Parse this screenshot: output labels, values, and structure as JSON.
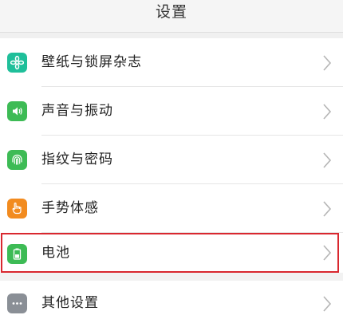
{
  "header": {
    "title": "设置"
  },
  "items": [
    {
      "label": "壁纸与锁屏杂志",
      "icon": "flower-icon",
      "color": "#1fbf9a"
    },
    {
      "label": "声音与振动",
      "icon": "speaker-icon",
      "color": "#3dbb55"
    },
    {
      "label": "指纹与密码",
      "icon": "fingerprint-icon",
      "color": "#3dbb55"
    },
    {
      "label": "手势体感",
      "icon": "hand-icon",
      "color": "#f28b1f"
    },
    {
      "label": "电池",
      "icon": "battery-icon",
      "color": "#3dbb55"
    },
    {
      "label": "其他设置",
      "icon": "more-icon",
      "color": "#8a8f96"
    }
  ],
  "highlight_color": "#d9282f"
}
